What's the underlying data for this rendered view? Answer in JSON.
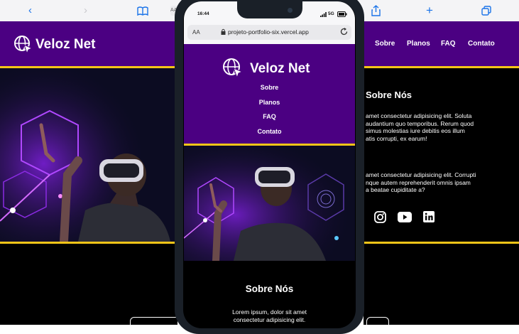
{
  "brand": {
    "name": "Veloz Net"
  },
  "nav": {
    "items": [
      "Sobre",
      "Planos",
      "FAQ",
      "Contato"
    ]
  },
  "browser": {
    "aa_label": "AA",
    "aa_small": "AA",
    "url": "projeto-portfolio-six.vercel.app"
  },
  "phone_status": {
    "time": "16:44",
    "network": "5G"
  },
  "about": {
    "title": "Sobre Nós",
    "p1": [
      "amet consectetur adipisicing elit. Soluta",
      "audantium quo temporibus. Rerum quod",
      "simus molestias iure debitis eos illum",
      "atis corrupti, ex earum!"
    ],
    "p2": [
      "amet consectetur adipisicing elit. Corrupti",
      "nque autem reprehenderit omnis ipsam",
      "a beatae cupiditate a?"
    ],
    "mobile_text": [
      "Lorem ipsum, dolor sit amet",
      "consectetur adipisicing elit."
    ]
  },
  "social": [
    "instagram-icon",
    "youtube-icon",
    "linkedin-icon"
  ],
  "colors": {
    "primary": "#4b0082",
    "accent": "#f5c518",
    "dark": "#000000"
  }
}
